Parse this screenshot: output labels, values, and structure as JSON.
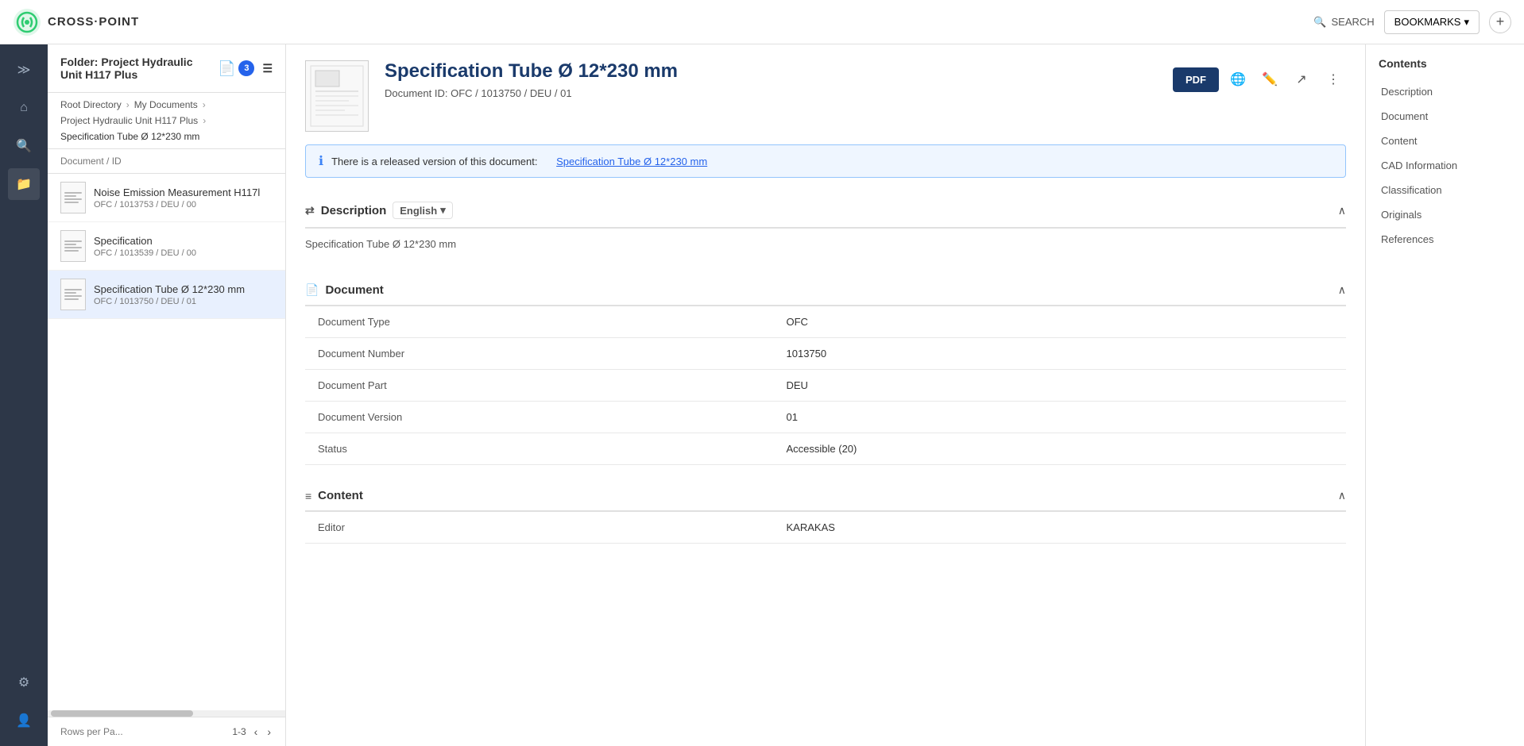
{
  "topNav": {
    "logoText": "CROSS·POINT",
    "searchLabel": "SEARCH",
    "bookmarksLabel": "BOOKMARKS",
    "addLabel": "+"
  },
  "folder": {
    "title": "Folder: Project Hydraulic Unit H117 Plus",
    "badgeCount": "3"
  },
  "breadcrumb": {
    "items": [
      "Root Directory",
      "My Documents",
      "Project Hydraulic Unit H117 Plus",
      "Specification Tube Ø 12*230 mm"
    ]
  },
  "docList": {
    "columnHeader": "Document / ID",
    "items": [
      {
        "name": "Noise Emission Measurement H117l",
        "id": "OFC / 1013753 / DEU / 00"
      },
      {
        "name": "Specification",
        "id": "OFC / 1013539 / DEU / 00"
      },
      {
        "name": "Specification Tube Ø 12*230 mm",
        "id": "OFC / 1013750 / DEU / 01"
      }
    ],
    "rowsPerPage": "Rows per Pa...",
    "pagination": "1-3"
  },
  "document": {
    "title": "Specification Tube Ø 12*230 mm",
    "idLabel": "Document ID:",
    "idValue": "OFC / 1013750 / DEU / 01",
    "pdfButtonLabel": "PDF",
    "infoBannerText": "There is a released version of this document:",
    "infoBannerLink": "Specification Tube Ø 12*230 mm"
  },
  "description": {
    "sectionLabel": "Description",
    "languageLabel": "English",
    "text": "Specification Tube Ø 12*230 mm"
  },
  "documentSection": {
    "sectionLabel": "Document",
    "fields": [
      {
        "label": "Document Type",
        "value": "OFC"
      },
      {
        "label": "Document Number",
        "value": "1013750"
      },
      {
        "label": "Document Part",
        "value": "DEU"
      },
      {
        "label": "Document Version",
        "value": "01"
      },
      {
        "label": "Status",
        "value": "Accessible (20)"
      }
    ]
  },
  "contentSection": {
    "sectionLabel": "Content",
    "fields": [
      {
        "label": "Editor",
        "value": "KARAKAS"
      }
    ]
  },
  "contents": {
    "title": "Contents",
    "items": [
      "Description",
      "Document",
      "Content",
      "CAD Information",
      "Classification",
      "Originals",
      "References"
    ]
  }
}
